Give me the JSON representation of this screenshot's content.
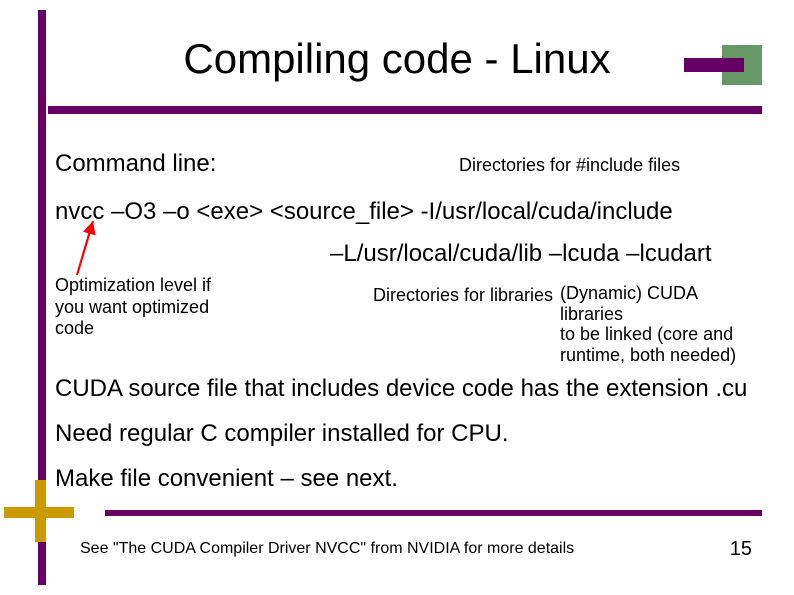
{
  "title": "Compiling code - Linux",
  "cmd_label": "Command line:",
  "include_note": "Directories for #include files",
  "cmd_line1": "nvcc –O3 –o <exe> <source_file> -I/usr/local/cuda/include",
  "cmd_line2": "–L/usr/local/cuda/lib –lcuda –lcudart",
  "opt_note_l1": "Optimization level if",
  "opt_note_l2": "you want optimized",
  "opt_note_l3": "code",
  "lib_dir_note": "Directories for  libraries",
  "dynamic_l1": "(Dynamic) CUDA libraries",
  "dynamic_l2": "to be linked (core and",
  "dynamic_l3": "runtime, both needed)",
  "body1_a": "CUDA source file that includes device code has the extension",
  "body1_b": ".cu",
  "body2": "Need regular C compiler installed for CPU.",
  "body3": "Make file convenient – see next.",
  "footnote": "See \"The CUDA Compiler Driver NVCC\" from NVIDIA for more details",
  "slide_num": "15"
}
